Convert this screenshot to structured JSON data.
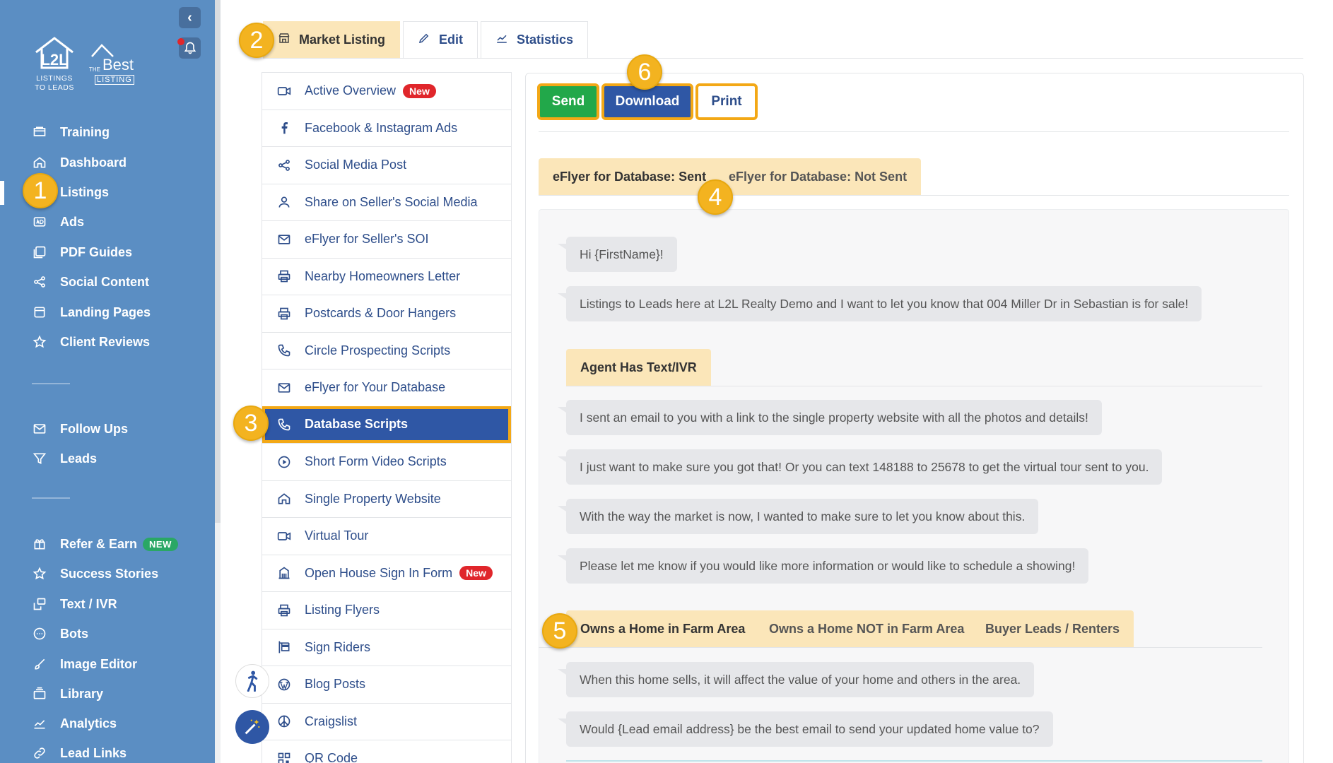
{
  "sidebar": {
    "logo1_lines": [
      "LISTINGS",
      "TO LEADS"
    ],
    "logo1_mark": "L2L",
    "logo2_lines": [
      "THE",
      "Best",
      "LISTING"
    ],
    "items": [
      {
        "label": "Training",
        "icon": "training-icon"
      },
      {
        "label": "Dashboard",
        "icon": "home-icon"
      },
      {
        "label": "Listings",
        "icon": "list-icon"
      },
      {
        "label": "Ads",
        "icon": "ad-icon"
      },
      {
        "label": "PDF Guides",
        "icon": "pdf-icon"
      },
      {
        "label": "Social Content",
        "icon": "share-icon"
      },
      {
        "label": "Landing Pages",
        "icon": "page-icon"
      },
      {
        "label": "Client Reviews",
        "icon": "star-icon"
      },
      {
        "label": "Follow Ups",
        "icon": "mail-icon"
      },
      {
        "label": "Leads",
        "icon": "filter-icon"
      },
      {
        "label": "Refer & Earn",
        "icon": "gift-icon",
        "badge": "NEW"
      },
      {
        "label": "Success Stories",
        "icon": "star-icon"
      },
      {
        "label": "Text / IVR",
        "icon": "message-icon"
      },
      {
        "label": "Bots",
        "icon": "chat-icon"
      },
      {
        "label": "Image Editor",
        "icon": "brush-icon"
      },
      {
        "label": "Library",
        "icon": "library-icon"
      },
      {
        "label": "Analytics",
        "icon": "chart-icon"
      },
      {
        "label": "Lead Links",
        "icon": "link-icon"
      }
    ]
  },
  "tabs": [
    {
      "label": "Market Listing",
      "icon": "store-icon"
    },
    {
      "label": "Edit",
      "icon": "pencil-icon"
    },
    {
      "label": "Statistics",
      "icon": "chart-line-icon"
    }
  ],
  "menu": [
    {
      "label": "Active Overview",
      "icon": "video-icon",
      "badge": "New"
    },
    {
      "label": "Facebook & Instagram Ads",
      "icon": "facebook-icon"
    },
    {
      "label": "Social Media Post",
      "icon": "share-icon"
    },
    {
      "label": "Share on Seller's Social Media",
      "icon": "user-icon"
    },
    {
      "label": "eFlyer for Seller's SOI",
      "icon": "mail-icon"
    },
    {
      "label": "Nearby Homeowners Letter",
      "icon": "printer-icon"
    },
    {
      "label": "Postcards & Door Hangers",
      "icon": "printer-icon"
    },
    {
      "label": "Circle Prospecting Scripts",
      "icon": "phone-icon"
    },
    {
      "label": "eFlyer for Your Database",
      "icon": "mail-icon"
    },
    {
      "label": "Database Scripts",
      "icon": "phone-icon"
    },
    {
      "label": "Short Form Video Scripts",
      "icon": "play-icon"
    },
    {
      "label": "Single Property Website",
      "icon": "home-icon"
    },
    {
      "label": "Virtual Tour",
      "icon": "video-icon"
    },
    {
      "label": "Open House Sign In Form",
      "icon": "building-icon",
      "badge": "New"
    },
    {
      "label": "Listing Flyers",
      "icon": "printer-icon"
    },
    {
      "label": "Sign Riders",
      "icon": "sign-icon"
    },
    {
      "label": "Blog Posts",
      "icon": "wordpress-icon"
    },
    {
      "label": "Craigslist",
      "icon": "peace-icon"
    },
    {
      "label": "QR Code",
      "icon": "qr-icon"
    }
  ],
  "actions": {
    "send": "Send",
    "download": "Download",
    "print": "Print"
  },
  "subtabs": [
    "eFlyer for Database: Sent",
    "eFlyer for Database: Not Sent"
  ],
  "messages": [
    "Hi {FirstName}!",
    "Listings to Leads here at L2L Realty Demo and I want to let you know that 004 Miller Dr in Sebastian is for sale!"
  ],
  "agent_tab": "Agent Has Text/IVR",
  "agent_messages": [
    "I sent an email to you with a link to the single property website with all the photos and details!",
    "I just want to make sure you got that! Or you can text 148188 to 25678 to get the virtual tour sent to you.",
    "With the way the market is now, I wanted to make sure to let you know about this.",
    "Please let me know if you would like more information or would like to schedule a showing!"
  ],
  "section_tabs": [
    "Owns a Home in Farm Area",
    "Owns a Home NOT in Farm Area",
    "Buyer Leads / Renters"
  ],
  "farm_messages": [
    "When this home sells, it will affect the value of your home and others in the area.",
    "Would {Lead email address} be the best email to send your updated home value to?"
  ],
  "step_badges": [
    "1",
    "2",
    "3",
    "4",
    "5",
    "6"
  ],
  "colors": {
    "sidebar": "#5b8ec3",
    "accent_orange": "#f3a816",
    "active_blue": "#2f57a5",
    "send_green": "#22a84a",
    "tab_tan": "#fbe6b9"
  }
}
